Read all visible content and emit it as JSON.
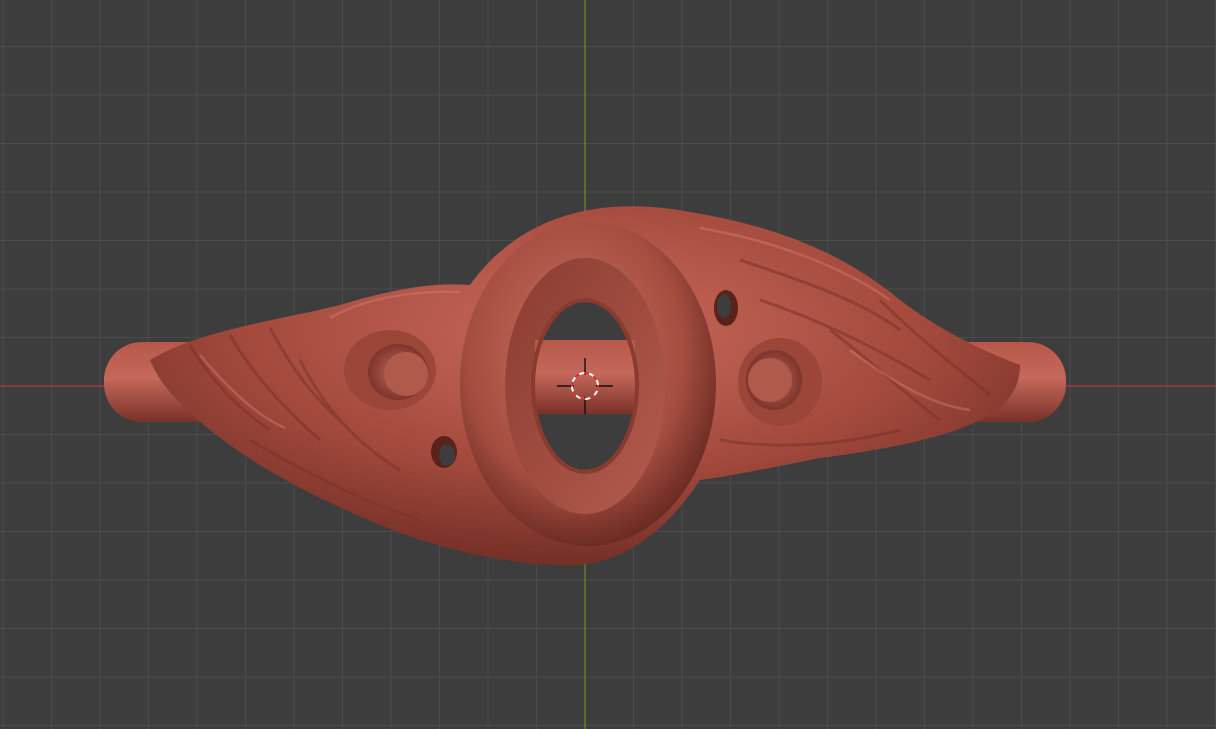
{
  "viewport": {
    "background_color": "#3d3d3d",
    "grid_line_color": "#4b4b4b",
    "x_axis_color": "#b33a42",
    "y_axis_color": "#6a8a2a",
    "mesh_color": "#a14a3e",
    "mesh_highlight_color": "#c66a5c",
    "mesh_shadow_color": "#6a2a22",
    "cursor_ring_colors": [
      "#ffffff",
      "#d8242a"
    ],
    "cursor_icon": "3d-cursor-icon",
    "object": "sculpted-ring-mesh",
    "view": "orthographic-top"
  }
}
